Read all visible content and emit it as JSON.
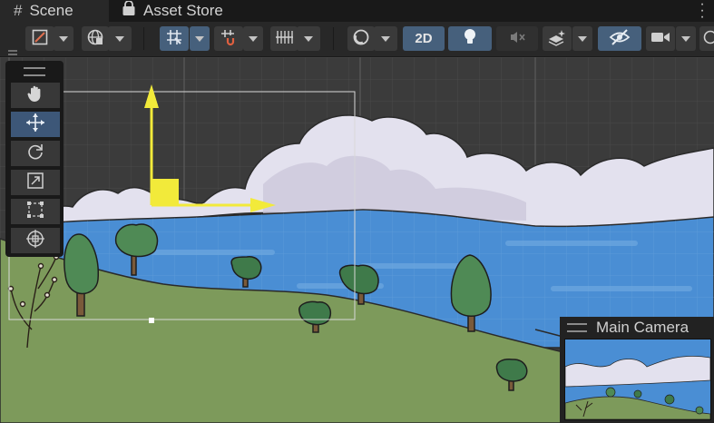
{
  "tabs": [
    {
      "label": "Scene",
      "icon": "grid-hash-icon",
      "active": true
    },
    {
      "label": "Asset Store",
      "icon": "shopping-bag-icon",
      "active": false
    }
  ],
  "toolbar": {
    "mode_2d_label": "2D",
    "accent": "#46607c"
  },
  "tools": [
    {
      "name": "hand-tool",
      "icon": "hand-icon",
      "active": false
    },
    {
      "name": "move-tool",
      "icon": "move-arrows-icon",
      "active": true
    },
    {
      "name": "rotate-tool",
      "icon": "rotate-icon",
      "active": false
    },
    {
      "name": "scale-tool",
      "icon": "scale-icon",
      "active": false
    },
    {
      "name": "rect-tool",
      "icon": "rect-transform-icon",
      "active": false
    },
    {
      "name": "transform-tool",
      "icon": "transform-icon",
      "active": false
    }
  ],
  "camera_preview": {
    "title": "Main Camera"
  },
  "gizmo_colors": {
    "x_axis": "#f2ea3a",
    "y_axis": "#f2ea3a"
  }
}
